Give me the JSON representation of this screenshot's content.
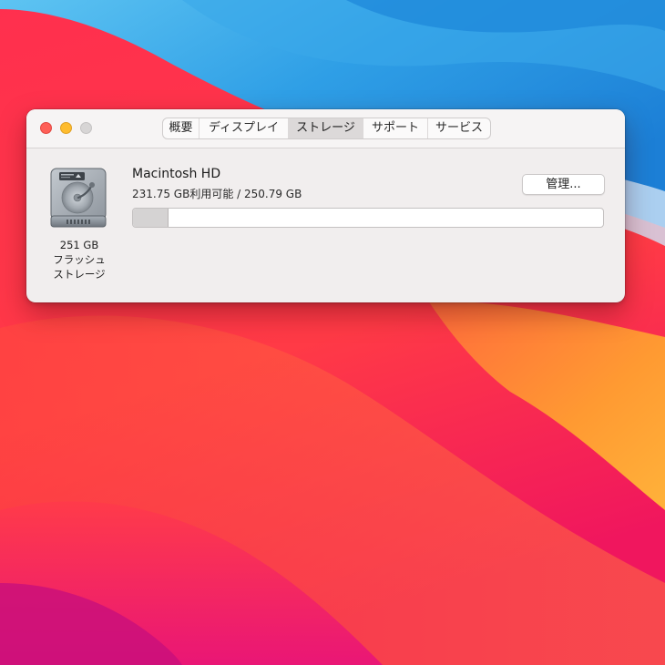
{
  "window": {
    "traffic_lights": {
      "close_color": "#fe5f57",
      "minimize_color": "#febc2e",
      "zoom_color": "#d7d5d5"
    },
    "tabs": [
      {
        "label": "概要",
        "selected": false
      },
      {
        "label": "ディスプレイ",
        "selected": false
      },
      {
        "label": "ストレージ",
        "selected": true
      },
      {
        "label": "サポート",
        "selected": false
      },
      {
        "label": "サービス",
        "selected": false
      }
    ]
  },
  "storage": {
    "drive": {
      "icon": "internal-drive-icon",
      "caption_lines": [
        "251 GB",
        "フラッシュ",
        "ストレージ"
      ]
    },
    "volume_name": "Macintosh HD",
    "space_text": "231.75 GB利用可能 / 250.79 GB",
    "used_fraction": 0.076,
    "manage_label": "管理..."
  },
  "colors": {
    "accent_tab": "#dcd9d9",
    "wallpaper_red": "#ff2a4a",
    "wallpaper_blue": "#2f9fe6",
    "wallpaper_orange": "#ffa13a"
  }
}
